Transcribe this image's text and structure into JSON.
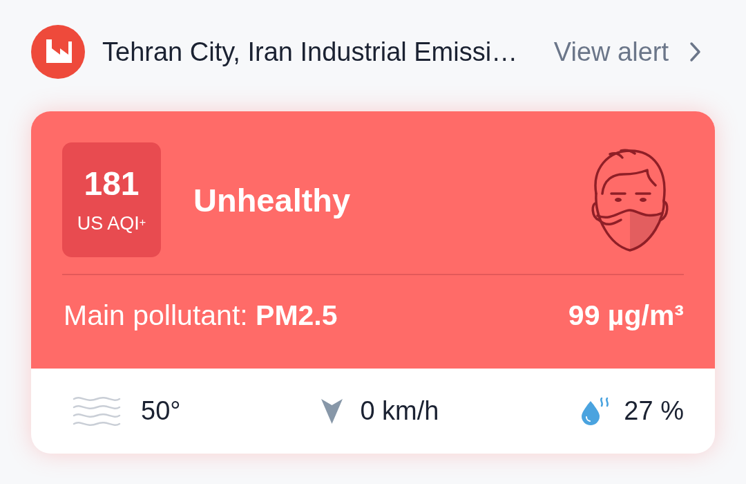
{
  "alert": {
    "title": "Tehran City, Iran Industrial Emissi…",
    "link": "View alert"
  },
  "aqi_card": {
    "aqi_value": "181",
    "aqi_scale": "US AQI$^{+}$",
    "status": "Unhealthy",
    "main_pollutant": "Main pollutant: **PM2.5**",
    "concentration": "99 µg/m³"
  },
  "weather": [
    {
      "kind": "temperature",
      "value": "50°"
    },
    {
      "kind": "wind",
      "value": "0 km/h"
    },
    {
      "kind": "humidity",
      "value": "27 %"
    }
  ]
}
